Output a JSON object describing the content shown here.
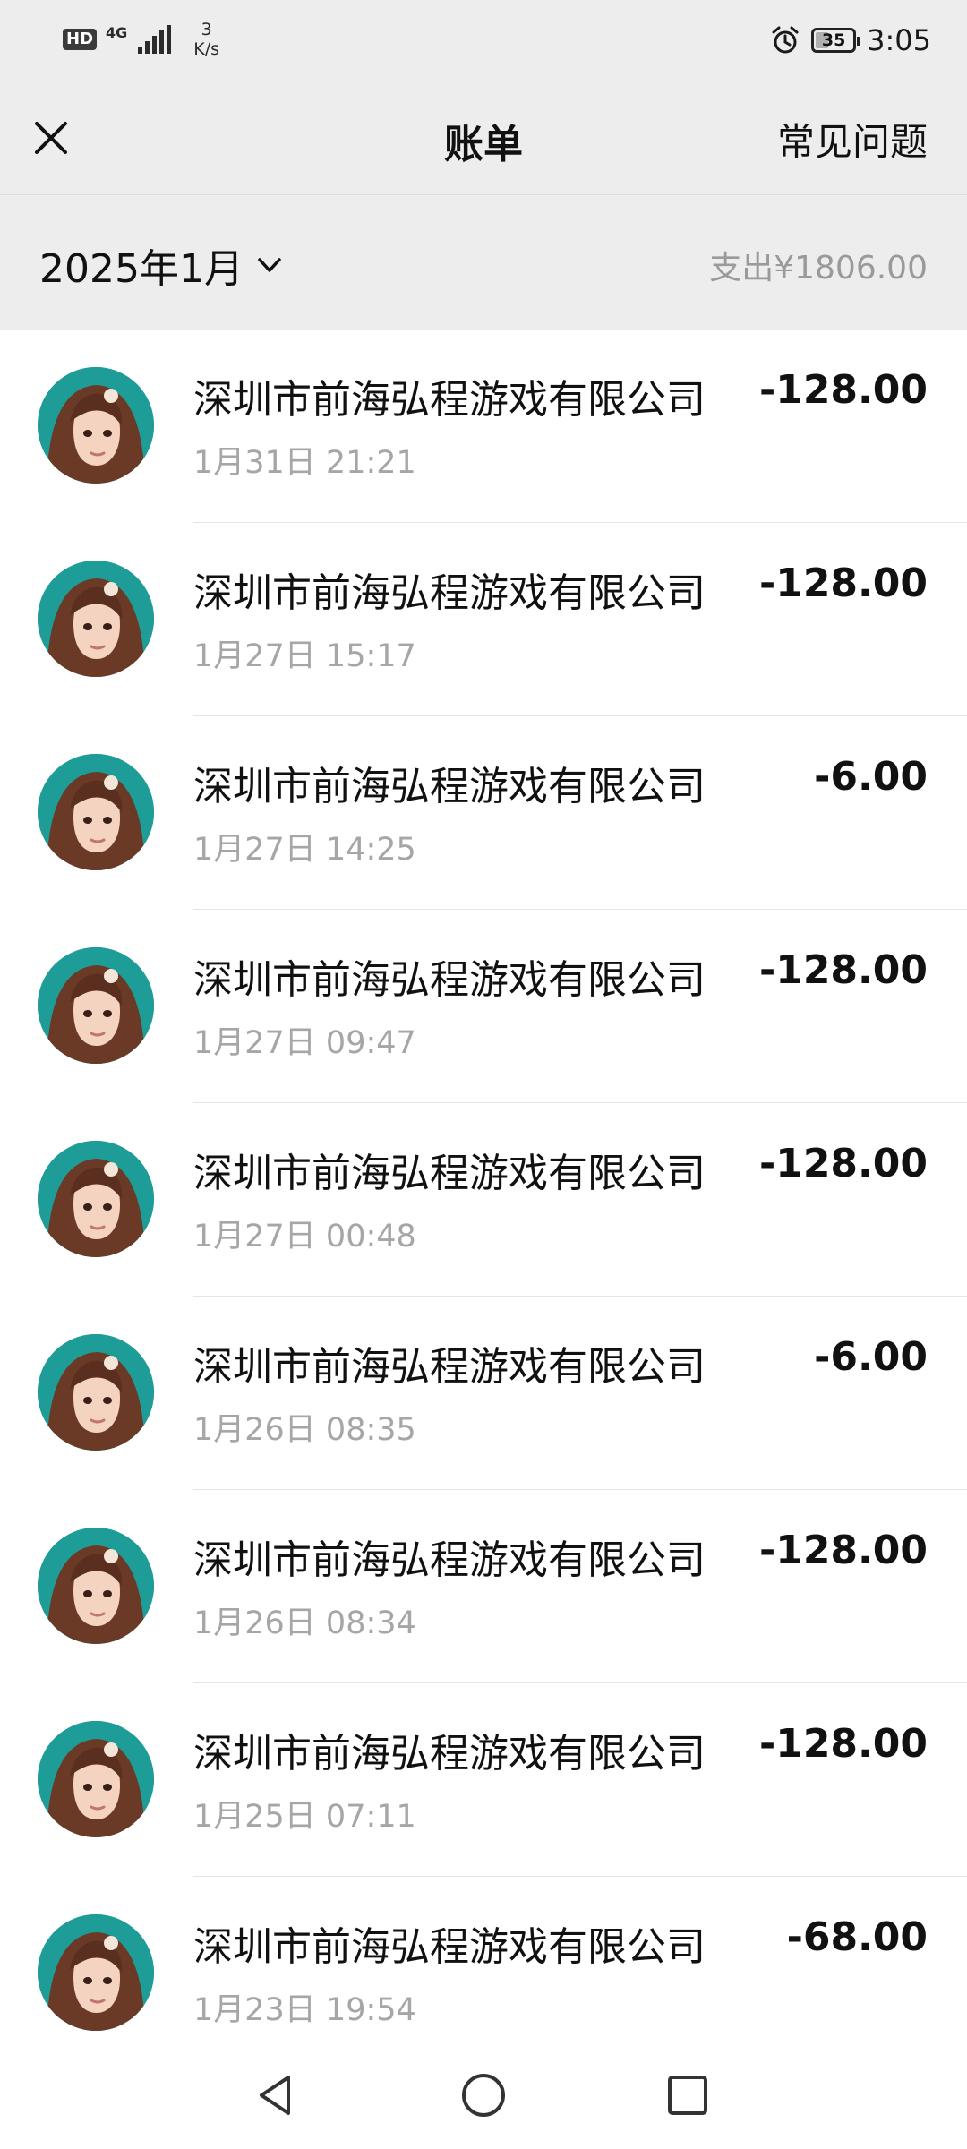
{
  "status_bar": {
    "hd": "HD",
    "network": "4G",
    "speed_value": "3",
    "speed_unit": "K/s",
    "battery": "35",
    "time": "3:05",
    "icons": [
      "signal-icon",
      "alarm-icon",
      "battery-icon"
    ]
  },
  "header": {
    "title": "账单",
    "faq": "常见问题",
    "close_icon": "close-icon"
  },
  "summary": {
    "month": "2025年1月",
    "expense": "支出¥1806.00"
  },
  "transactions": [
    {
      "merchant": "深圳市前海弘程游戏有限公司",
      "time": "1月31日 21:21",
      "amount": "-128.00"
    },
    {
      "merchant": "深圳市前海弘程游戏有限公司",
      "time": "1月27日 15:17",
      "amount": "-128.00"
    },
    {
      "merchant": "深圳市前海弘程游戏有限公司",
      "time": "1月27日 14:25",
      "amount": "-6.00"
    },
    {
      "merchant": "深圳市前海弘程游戏有限公司",
      "time": "1月27日 09:47",
      "amount": "-128.00"
    },
    {
      "merchant": "深圳市前海弘程游戏有限公司",
      "time": "1月27日 00:48",
      "amount": "-128.00"
    },
    {
      "merchant": "深圳市前海弘程游戏有限公司",
      "time": "1月26日 08:35",
      "amount": "-6.00"
    },
    {
      "merchant": "深圳市前海弘程游戏有限公司",
      "time": "1月26日 08:34",
      "amount": "-128.00"
    },
    {
      "merchant": "深圳市前海弘程游戏有限公司",
      "time": "1月25日 07:11",
      "amount": "-128.00"
    },
    {
      "merchant": "深圳市前海弘程游戏有限公司",
      "time": "1月23日 19:54",
      "amount": "-68.00"
    }
  ],
  "nav": {
    "icons": [
      "back-icon",
      "home-icon",
      "recents-icon"
    ]
  },
  "colors": {
    "header_bg": "#ededed",
    "avatar_bg": "#1e9c98",
    "muted_text": "#a6a6a6"
  }
}
